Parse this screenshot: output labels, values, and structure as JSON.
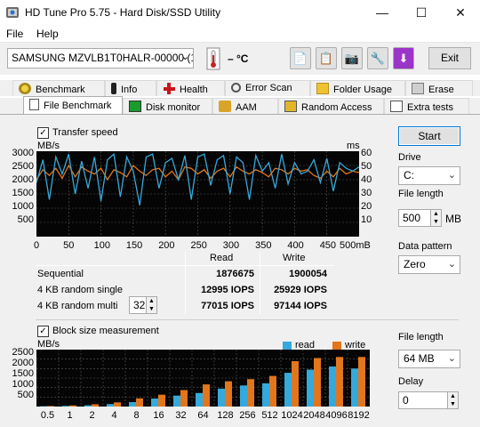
{
  "window": {
    "title": "HD Tune Pro 5.75 - Hard Disk/SSD Utility",
    "minimize": "—",
    "maximize": "☐",
    "close": "✕"
  },
  "menu": {
    "file": "File",
    "help": "Help"
  },
  "toolbar": {
    "drive": "SAMSUNG MZVLB1T0HALR-00000 (1024",
    "temperature": "– °C",
    "exit_label": "Exit"
  },
  "tabs_top": [
    "Benchmark",
    "Info",
    "Health",
    "Error Scan",
    "Folder Usage",
    "Erase"
  ],
  "tabs_bottom": [
    "File Benchmark",
    "Disk monitor",
    "AAM",
    "Random Access",
    "Extra tests"
  ],
  "transfer": {
    "checkbox_label": "Transfer speed",
    "left_unit": "MB/s",
    "right_unit": "ms",
    "y_left_ticks": [
      "3000",
      "2500",
      "2000",
      "1500",
      "1000",
      "500"
    ],
    "y_right_ticks": [
      "60",
      "50",
      "40",
      "30",
      "20",
      "10"
    ],
    "x_ticks": [
      "0",
      "50",
      "100",
      "150",
      "200",
      "250",
      "300",
      "350",
      "400",
      "450",
      "500mB"
    ]
  },
  "results": {
    "col_read": "Read",
    "col_write": "Write",
    "rows": [
      {
        "label": "Sequential",
        "read": "1876675",
        "write": "1900054"
      },
      {
        "label": "4 KB random single",
        "read": "12995 IOPS",
        "write": "25929 IOPS"
      },
      {
        "label": "4 KB random multi",
        "read": "77015 IOPS",
        "write": "97144 IOPS"
      }
    ],
    "queue_depth": "32"
  },
  "block": {
    "checkbox_label": "Block size measurement",
    "unit": "MB/s",
    "legend_read": "read",
    "legend_write": "write",
    "y_ticks": [
      "2500",
      "2000",
      "1500",
      "1000",
      "500"
    ]
  },
  "side": {
    "start_label": "Start",
    "drive_label": "Drive",
    "drive_value": "C:",
    "file_length_label": "File length",
    "file_length_value": "500",
    "file_length_unit": "MB",
    "data_pattern_label": "Data pattern",
    "data_pattern_value": "Zero",
    "file_length2_label": "File length",
    "file_length2_value": "64 MB",
    "delay_label": "Delay",
    "delay_value": "0"
  },
  "colors": {
    "read": "#35a9dc",
    "write": "#e2761c",
    "graph_bg": "#050505",
    "grid": "#5a5a5a"
  },
  "chart_data": [
    {
      "type": "line",
      "title": "Transfer speed",
      "xlabel": "mB",
      "ylabel": "MB/s",
      "xlim": [
        0,
        500
      ],
      "ylim": [
        0,
        3000
      ],
      "y2lim": [
        0,
        60
      ],
      "grid": true,
      "series": [
        {
          "name": "Read",
          "axis": "left",
          "color": "#35a9dc",
          "x": [
            0,
            10,
            20,
            30,
            40,
            50,
            60,
            70,
            80,
            90,
            100,
            110,
            120,
            130,
            140,
            150,
            160,
            170,
            180,
            190,
            200,
            210,
            220,
            230,
            240,
            250,
            260,
            270,
            280,
            290,
            300,
            310,
            320,
            330,
            340,
            350,
            360,
            370,
            380,
            390,
            400,
            410,
            420,
            430,
            440,
            450,
            460,
            470,
            480,
            490,
            500
          ],
          "values": [
            1900,
            2700,
            1300,
            2800,
            2200,
            2900,
            1500,
            2650,
            1700,
            2800,
            1250,
            2700,
            2900,
            1400,
            2800,
            2300,
            1100,
            2800,
            2900,
            1700,
            2600,
            2750,
            2000,
            2850,
            1300,
            2800,
            2900,
            1800,
            2700,
            2850,
            1500,
            2800,
            2600,
            1300,
            2850,
            2300,
            2600,
            1700,
            2900,
            1850,
            2600,
            2200,
            2300,
            2700,
            1900,
            2750,
            1600,
            2600,
            2400,
            2300,
            2450
          ]
        },
        {
          "name": "Write",
          "axis": "left",
          "color": "#e2761c",
          "x": [
            0,
            10,
            20,
            30,
            40,
            50,
            60,
            70,
            80,
            90,
            100,
            110,
            120,
            130,
            140,
            150,
            160,
            170,
            180,
            190,
            200,
            210,
            220,
            230,
            240,
            250,
            260,
            270,
            280,
            290,
            300,
            310,
            320,
            330,
            340,
            350,
            360,
            370,
            380,
            390,
            400,
            410,
            420,
            430,
            440,
            450,
            460,
            470,
            480,
            490,
            500
          ],
          "values": [
            2000,
            2350,
            2150,
            2400,
            2050,
            2500,
            2100,
            2450,
            2300,
            2200,
            2400,
            2000,
            2350,
            2250,
            2100,
            2500,
            2300,
            2150,
            2350,
            2400,
            2100,
            2300,
            2000,
            2450,
            2400,
            2200,
            2350,
            2050,
            2300,
            2400,
            2100,
            2450,
            2300,
            2200,
            2350,
            2250,
            2100,
            2400,
            2350,
            2200,
            2400,
            2300,
            2350,
            2150,
            2050,
            2300,
            2100,
            2400,
            2200,
            2300,
            2250
          ]
        }
      ]
    },
    {
      "type": "bar",
      "title": "Block size measurement",
      "ylabel": "MB/s",
      "ylim": [
        0,
        2700
      ],
      "categories": [
        "0.5",
        "1",
        "2",
        "4",
        "8",
        "16",
        "32",
        "64",
        "128",
        "256",
        "512",
        "1024",
        "2048",
        "4096",
        "8192"
      ],
      "series": [
        {
          "name": "read",
          "color": "#35a9dc",
          "values": [
            15,
            30,
            60,
            120,
            210,
            380,
            520,
            640,
            850,
            1000,
            1100,
            1600,
            1750,
            1900,
            1800
          ]
        },
        {
          "name": "write",
          "color": "#e2761c",
          "values": [
            25,
            55,
            110,
            200,
            390,
            560,
            780,
            1050,
            1200,
            1300,
            1450,
            2150,
            2300,
            2350,
            2350
          ]
        }
      ]
    }
  ]
}
